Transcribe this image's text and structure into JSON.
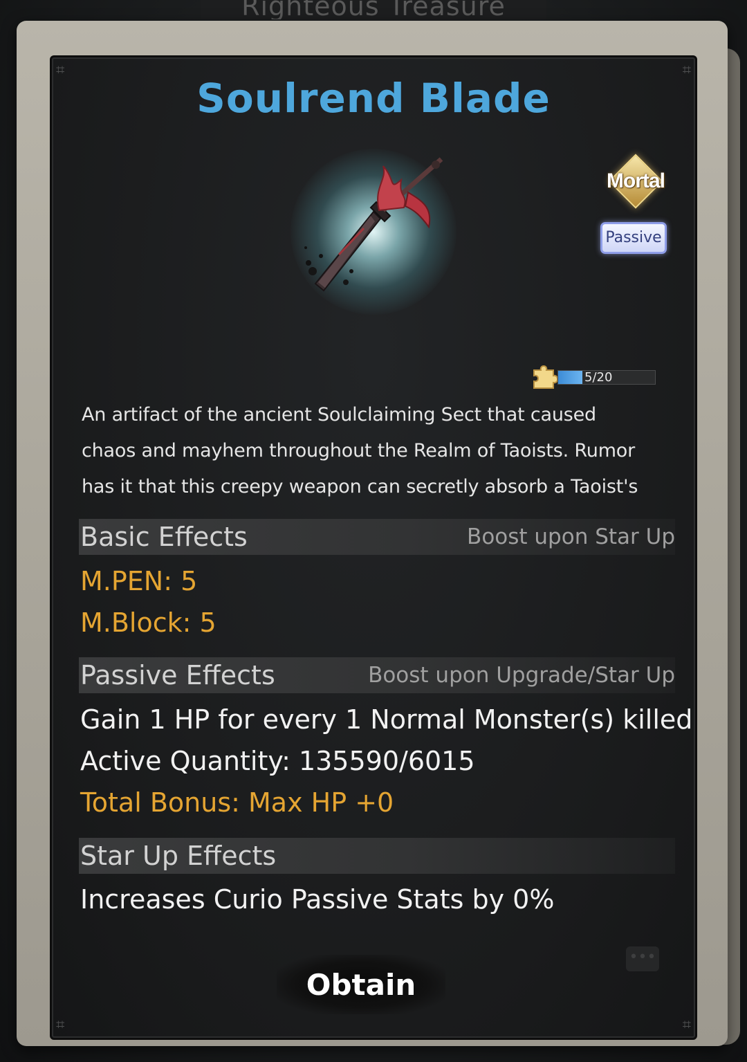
{
  "background": {
    "header_title": "Righteous Treasure"
  },
  "item": {
    "name": "Soulrend Blade",
    "rank": "Mortal",
    "type": "Passive",
    "shards": {
      "label": "5/20",
      "current": 5,
      "max": 20
    },
    "description": [
      "An artifact of the ancient Soulclaiming Sect that caused",
      "chaos and mayhem throughout the Realm of Taoists. Rumor",
      "has it that this creepy weapon can secretly absorb a Taoist's"
    ]
  },
  "basic_effects": {
    "title": "Basic Effects",
    "hint": "Boost upon Star Up",
    "lines": [
      "M.PEN: 5",
      "M.Block: 5"
    ]
  },
  "passive_effects": {
    "title": "Passive Effects",
    "hint": "Boost upon Upgrade/Star Up",
    "effect": "Gain 1 HP for every 1 Normal Monster(s) killed",
    "active_quantity": "Active Quantity: 135590/6015",
    "total_bonus": "Total Bonus: Max HP +0"
  },
  "star_up_effects": {
    "title": "Star Up Effects",
    "effect": "Increases Curio Passive Stats by 0%"
  },
  "actions": {
    "obtain_label": "Obtain"
  },
  "colors": {
    "title": "#4ea7dc",
    "gold_text": "#e5a532",
    "progress_fill": "#4a9be0"
  }
}
